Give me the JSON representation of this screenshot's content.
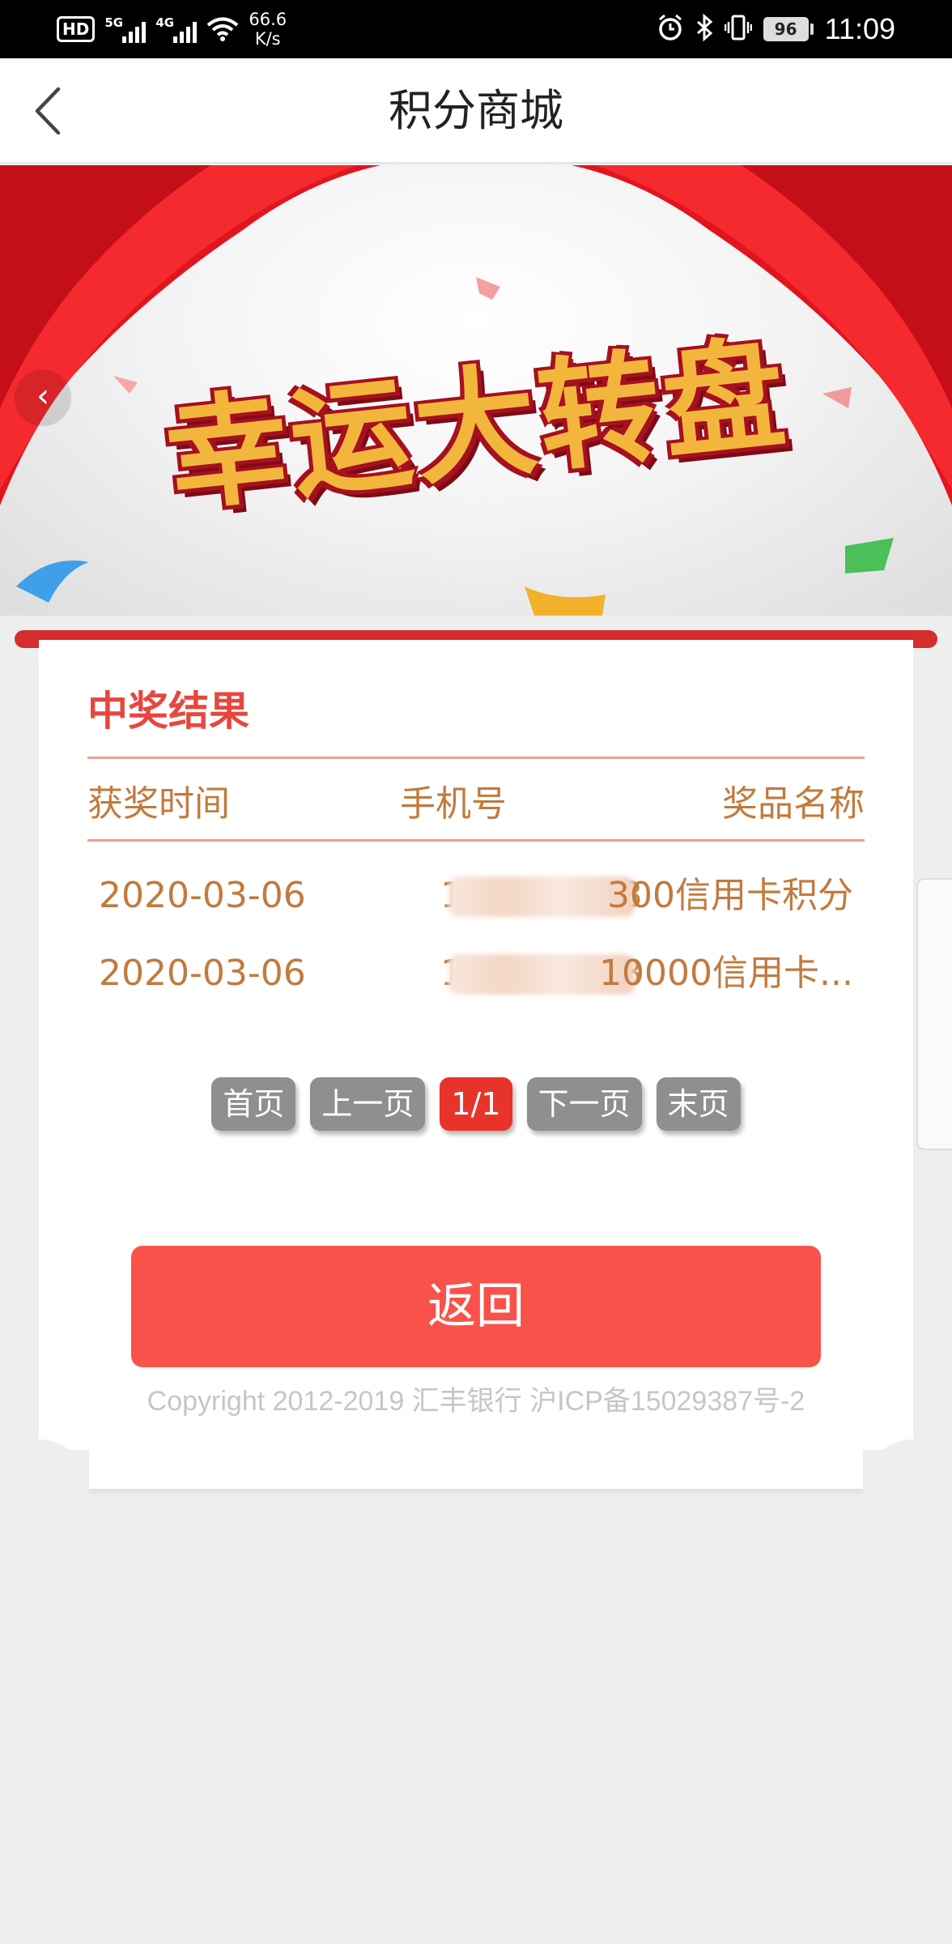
{
  "status_bar": {
    "hd": "HD",
    "net1": "5G",
    "net2": "4G",
    "speed_value": "66.6",
    "speed_unit": "K/s",
    "battery": "96",
    "time": "11:09"
  },
  "navbar": {
    "title": "积分商城",
    "back_icon": "chevron-left-icon"
  },
  "banner": {
    "title": "幸运大转盘",
    "prev_icon": "chevron-left-icon"
  },
  "results": {
    "title": "中奖结果",
    "headers": [
      "获奖时间",
      "手机号",
      "奖品名称"
    ],
    "rows": [
      {
        "date": "2020-03-06",
        "phone_start": "1",
        "phone_end": "3",
        "prize": "300信用卡积分"
      },
      {
        "date": "2020-03-06",
        "phone_start": "1",
        "phone_end": "3",
        "prize": "10000信用卡..."
      }
    ]
  },
  "pager": {
    "first": "首页",
    "prev": "上一页",
    "current": "1/1",
    "next": "下一页",
    "last": "末页"
  },
  "actions": {
    "back_label": "返回"
  },
  "footer": {
    "copyright": "Copyright 2012-2019 汇丰银行 沪ICP备15029387号-2"
  },
  "colors": {
    "accent_red": "#e8332b",
    "button_red": "#f9524a",
    "text_brown": "#c27a3e",
    "pager_gray": "#8f8f8f"
  }
}
